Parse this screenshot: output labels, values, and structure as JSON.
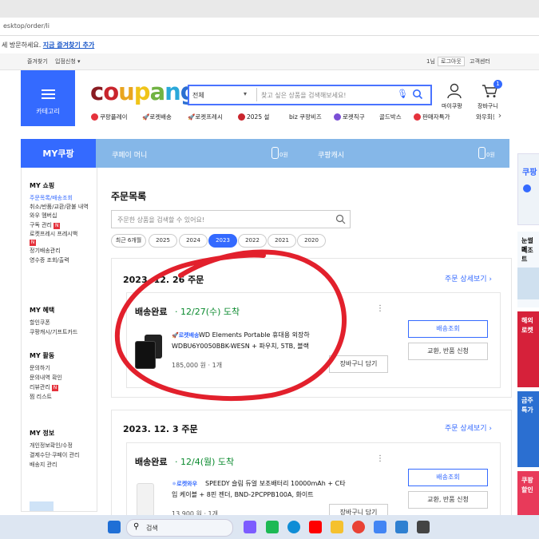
{
  "browser": {
    "url": "esktop/order/li",
    "favbar_text": "세 방문하세요.",
    "favbar_link": "지금 즐겨찾기 추가"
  },
  "util": {
    "left1": "즐겨찾기",
    "left2": "입점신청 ▾",
    "right1": "1님",
    "right2": "로그아웃",
    "right3": "고객센터"
  },
  "header": {
    "category_label": "카테고리",
    "logo": "coupang",
    "logo_colors": [
      "#8a1c22",
      "#c9252d",
      "#e9a51f",
      "#f0c419",
      "#71b343",
      "#2aa8d9",
      "#2b6fd1"
    ],
    "search_select": "전체",
    "search_placeholder": "찾고 싶은 상품을 검색해보세요!",
    "mypage": "마이쿠팡",
    "cart": "장바구니",
    "cart_count": "1"
  },
  "quicklinks": [
    "쿠팡플레이",
    "로켓배송",
    "로켓프레시",
    "2025 설",
    "biz 쿠팡비즈",
    "로켓직구",
    "골드박스",
    "판매자특가",
    "와우회원"
  ],
  "myband": {
    "title": "MY쿠팡",
    "coupay_money": "쿠페이 머니",
    "coupay_money_value": "0원",
    "coupang_cash": "쿠팡캐시",
    "coupang_cash_value": "0원"
  },
  "sidebar": {
    "sections": [
      {
        "head": "MY 쇼핑",
        "items": [
          "주문목록/배송조회",
          "취소/반품/교환/환불 내역",
          "와우 멤버십",
          "구독 관리",
          "로켓프레시 프레시백",
          "정기배송관리",
          "영수증 조회/출력"
        ]
      },
      {
        "head": "MY 혜택",
        "items": [
          "할인쿠폰",
          "쿠팡캐시/기프트카드"
        ]
      },
      {
        "head": "MY 활동",
        "items": [
          "문의하기",
          "문의내역 확인",
          "리뷰관리",
          "찜 리스트"
        ]
      },
      {
        "head": "MY 정보",
        "items": [
          "개인정보확인/수정",
          "결제수단·쿠페이 관리",
          "배송지 관리"
        ]
      }
    ],
    "badge": "N"
  },
  "orders_page": {
    "title": "주문목록",
    "search_placeholder": "주문한 상품을 검색할 수 있어요!",
    "year_filters": [
      "최근 6개월",
      "2025",
      "2024",
      "2023",
      "2022",
      "2021",
      "2020"
    ],
    "active_filter": "2023"
  },
  "orders": [
    {
      "date": "2023. 12. 26 주문",
      "detail_link": "주문 상세보기 ›",
      "status": "배송완료",
      "status_date": "· 12/27(수) 도착",
      "shipping_badge": "로켓배송",
      "product_line1": "WD Elements Portable 휴대용 외장하",
      "product_line2": "WDBU6Y0050BBK-WESN + 파우치, 5TB, 블랙",
      "price": "185,000 원 · 1개",
      "cart_button": "장바구니 담기",
      "track_button": "배송조회",
      "exchange_button": "교환, 반품 신청"
    },
    {
      "date": "2023. 12. 3 주문",
      "detail_link": "주문 상세보기 ›",
      "status": "배송완료",
      "status_date": "· 12/4(월) 도착",
      "shipping_badge": "로켓와우",
      "product_line1": "SPEEDY 슬림 듀얼 보조배터리 10000mAh + C타",
      "product_line2": "입 케이블 + 8핀 젠더, BND-2PCPPB100A, 화이트",
      "price": "13,900 원 · 1개",
      "cart_button": "장바구니 담기",
      "track_button": "배송조회",
      "exchange_button": "교환, 반품 신청"
    }
  ],
  "right_banners": [
    "쿠팡",
    "눈썰매",
    "리조트",
    "해외",
    "로켓",
    "금주",
    "특가",
    "쿠팡",
    "할인"
  ],
  "taskbar": {
    "search_label": "검색"
  },
  "colors": {
    "accent": "#346aff",
    "annotation": "#e2202c",
    "delivered_green": "#0a8a2e"
  }
}
